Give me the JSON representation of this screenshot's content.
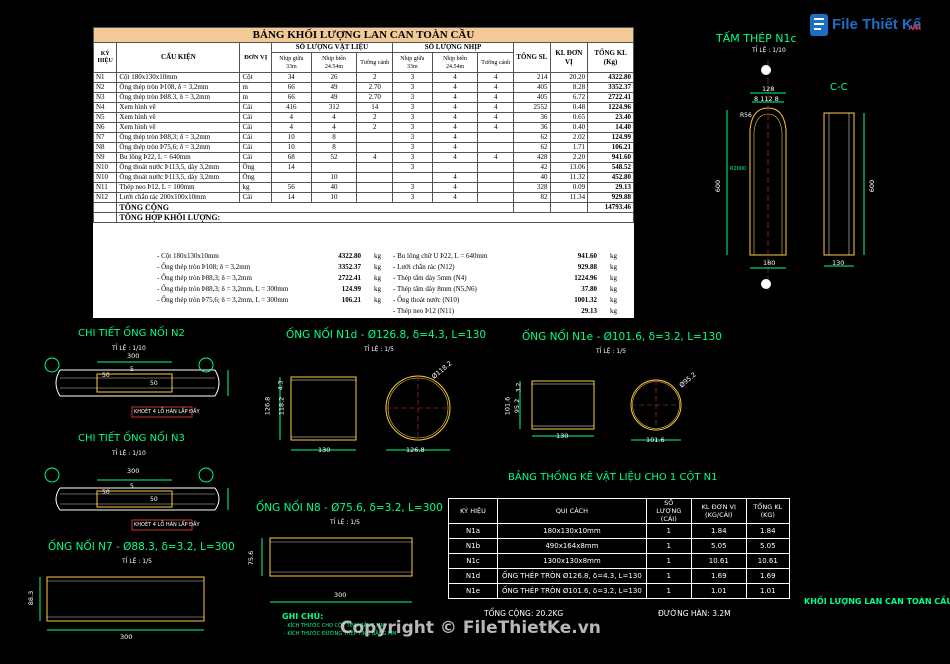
{
  "logo": {
    "brand": "File Thiết Kế",
    "domain": ".vn"
  },
  "watermark": "Copyright © FileThietKe.vn",
  "bom": {
    "title": "BẢNG KHỐI LƯỢNG LAN CAN TOÀN CẦU",
    "headers": {
      "kyhieu": "KÝ HIỆU",
      "caukien": "CẤU KIỆN",
      "donvi": "ĐƠN VỊ",
      "sl_vatlieu": "SỐ LƯỢNG VẬT LIỆU",
      "sl_nhip": "SỐ LƯỢNG NHỊP",
      "tong_sl": "TỔNG SL",
      "kl_donvi": "KL ĐƠN VỊ",
      "tong_kl": "TỔNG KL (Kg)",
      "nhip_giua": "Nhịp giữa 33m",
      "nhip_bien": "Nhịp biên 24.54m",
      "tuong_canh": "Tường cánh"
    },
    "rows": [
      {
        "id": "N1",
        "name": "Cột 180x130x10mm",
        "unit": "Cột",
        "a": "34",
        "b": "26",
        "c": "2",
        "d": "3",
        "e": "4",
        "f": "4",
        "sl": "214",
        "kl": "20.20",
        "tkl": "4322.80"
      },
      {
        "id": "N2",
        "name": "Ống thép tròn Þ108, δ = 3,2mm",
        "unit": "m",
        "a": "66",
        "b": "49",
        "c": "2.70",
        "d": "3",
        "e": "4",
        "f": "4",
        "sl": "405",
        "kl": "8.28",
        "tkl": "3352.37"
      },
      {
        "id": "N3",
        "name": "Ống thép tròn Þ88.3, δ = 3,2mm",
        "unit": "m",
        "a": "66",
        "b": "49",
        "c": "2.70",
        "d": "3",
        "e": "4",
        "f": "4",
        "sl": "405",
        "kl": "6.72",
        "tkl": "2722.41"
      },
      {
        "id": "N4",
        "name": "Xem hình vẽ",
        "unit": "Cái",
        "a": "416",
        "b": "312",
        "c": "14",
        "d": "3",
        "e": "4",
        "f": "4",
        "sl": "2552",
        "kl": "0.48",
        "tkl": "1224.96"
      },
      {
        "id": "N5",
        "name": "Xem hình vẽ",
        "unit": "Cái",
        "a": "4",
        "b": "4",
        "c": "2",
        "d": "3",
        "e": "4",
        "f": "4",
        "sl": "36",
        "kl": "0.65",
        "tkl": "23.40"
      },
      {
        "id": "N6",
        "name": "Xem hình vẽ",
        "unit": "Cái",
        "a": "4",
        "b": "4",
        "c": "2",
        "d": "3",
        "e": "4",
        "f": "4",
        "sl": "36",
        "kl": "0.40",
        "tkl": "14.40"
      },
      {
        "id": "N7",
        "name": "Ống thép tròn Þ88,3; δ = 3,2mm",
        "unit": "Cái",
        "a": "10",
        "b": "8",
        "c": "",
        "d": "3",
        "e": "4",
        "f": "",
        "sl": "62",
        "kl": "2.02",
        "tkl": "124.99"
      },
      {
        "id": "N8",
        "name": "Ống thép tròn Þ75,6; δ = 3,2mm",
        "unit": "Cái",
        "a": "10",
        "b": "8",
        "c": "",
        "d": "3",
        "e": "4",
        "f": "",
        "sl": "62",
        "kl": "1.71",
        "tkl": "106.21"
      },
      {
        "id": "N9",
        "name": "Bu lông Þ22, L = 640mm",
        "unit": "Cái",
        "a": "68",
        "b": "52",
        "c": "4",
        "d": "3",
        "e": "4",
        "f": "4",
        "sl": "428",
        "kl": "2.20",
        "tkl": "941.60"
      },
      {
        "id": "N10",
        "name": "Ống thoát nước Þ113,5, dày 3,2mm",
        "unit": "Ống",
        "a": "14",
        "b": "",
        "c": "",
        "d": "3",
        "e": "",
        "f": "",
        "sl": "42",
        "kl": "13.06",
        "tkl": "548.52"
      },
      {
        "id": "N10",
        "name": "Ống thoát nước Þ113,5, dày 3,2mm",
        "unit": "Ống",
        "a": "",
        "b": "10",
        "c": "",
        "d": "",
        "e": "4",
        "f": "",
        "sl": "40",
        "kl": "11.32",
        "tkl": "452.80"
      },
      {
        "id": "N11",
        "name": "Thép neo Þ12, L = 100mm",
        "unit": "kg",
        "a": "56",
        "b": "40",
        "c": "",
        "d": "3",
        "e": "4",
        "f": "",
        "sl": "328",
        "kl": "0.09",
        "tkl": "29.13"
      },
      {
        "id": "N12",
        "name": "Lưới chắn rác 200x100x10mm",
        "unit": "Cái",
        "a": "14",
        "b": "10",
        "c": "",
        "d": "3",
        "e": "4",
        "f": "",
        "sl": "82",
        "kl": "11.34",
        "tkl": "929.88"
      }
    ],
    "total_label": "TỔNG CỘNG",
    "total_value": "14793.46",
    "summary_title": "TỔNG HỢP KHỐI LƯỢNG:",
    "summary_left": [
      {
        "name": "- Cột 180x130x10mm",
        "val": "4322.80",
        "unit": "kg"
      },
      {
        "name": "- Ống thép tròn Þ108; δ = 3,2mm",
        "val": "3352.37",
        "unit": "kg"
      },
      {
        "name": "- Ống thép tròn Þ88,3; δ = 3,2mm",
        "val": "2722.41",
        "unit": "kg"
      },
      {
        "name": "- Ống thép tròn Þ88,3; δ = 3,2mm, L = 300mm",
        "val": "124.99",
        "unit": "kg"
      },
      {
        "name": "- Ống thép tròn Þ75,6; δ = 3,2mm, L = 300mm",
        "val": "106.21",
        "unit": "kg"
      }
    ],
    "summary_right": [
      {
        "name": "- Bu lông chữ U Þ22, L = 640mm",
        "val": "941.60",
        "unit": "kg"
      },
      {
        "name": "- Lưới chắn rác (N12)",
        "val": "929.88",
        "unit": "kg"
      },
      {
        "name": "- Thép tấm dày 5mm (N4)",
        "val": "1224.96",
        "unit": "kg"
      },
      {
        "name": "- Thép tấm dày 8mm (N5,N6)",
        "val": "37.80",
        "unit": "kg"
      },
      {
        "name": "- Ống thoát nước (N10)",
        "val": "1001.32",
        "unit": "kg"
      },
      {
        "name": "- Thép neo Þ12 (N11)",
        "val": "29.13",
        "unit": "kg"
      }
    ]
  },
  "drawings": {
    "n1c_title": "TẤM THÉP N1c",
    "n1c_scale": "TỈ LỆ : 1/10",
    "cc_title": "C-C",
    "n1c_dims": {
      "top": "128",
      "mid": "8 112 8",
      "r": "R56",
      "r2": "R2000",
      "h": "600",
      "w": "180",
      "cc_h": "600",
      "cc_w": "130"
    },
    "n2_title": "CHI TIẾT ỐNG NỐI N2",
    "n2_scale": "TỈ LỆ : 1/10",
    "n2_dims": {
      "l": "300",
      "a": "50",
      "b": "5",
      "c": "50"
    },
    "n2_note": "KHOÉT 4 LỖ HÀN LẤP ĐẦY",
    "n3_title": "CHI TIẾT ỐNG NỐI N3",
    "n3_scale": "TỈ LỆ : 1/10",
    "n3_dims": {
      "l": "300",
      "a": "50",
      "b": "5",
      "c": "50"
    },
    "n3_note": "KHOÉT 4 LỖ HÀN LẤP ĐẦY",
    "n1d_title": "ỐNG NỐI N1d - Ø126.8, δ=4.3, L=130",
    "n1d_scale": "TỈ LỆ : 1/5",
    "n1d_dims": {
      "h": "126.8",
      "h2": "118.2",
      "t": "4.3",
      "w": "130",
      "d": "126.8",
      "dd": "Ø118.2"
    },
    "n1e_title": "ỐNG NỐI N1e - Ø101.6, δ=3.2, L=130",
    "n1e_scale": "TỈ LỆ : 1/5",
    "n1e_dims": {
      "h": "101.6",
      "h2": "95.2",
      "t": "3.2",
      "w": "130",
      "d": "101.6",
      "dd": "Ø95.2"
    },
    "n8_title": "ỐNG NỐI N8 - Ø75.6, δ=3.2, L=300",
    "n8_scale": "TỈ LỆ : 1/5",
    "n8_dims": {
      "h": "75.6",
      "w": "300"
    },
    "n7_title": "ỐNG NỐI N7 - Ø88.3, δ=3.2, L=300",
    "n7_scale": "TỈ LỆ : 1/5",
    "n7_dims": {
      "h": "88.3",
      "w": "300"
    },
    "notes_title": "GHI CHÚ:",
    "notes": [
      "- KÍCH THƯỚC CHO CỘT TÍNH BẰNG MM",
      "- KÍCH THƯỚC ĐƯỜNG THÉP TÍNH BẰNG MM"
    ],
    "bottom_right": "KHỐI LƯỢNG LAN CAN TOÀN CẦU"
  },
  "tk": {
    "title": "BẢNG THỐNG KÊ VẬT LIỆU CHO 1 CỘT N1",
    "headers": [
      "KÝ HIỆU",
      "QUI CÁCH",
      "SỐ LƯỢNG (CÁI)",
      "KL ĐƠN VỊ (KG/CÁI)",
      "TỔNG KL (KG)"
    ],
    "rows": [
      [
        "N1a",
        "180x130x10mm",
        "1",
        "1.84",
        "1.84"
      ],
      [
        "N1b",
        "490x164x8mm",
        "1",
        "5.05",
        "5.05"
      ],
      [
        "N1c",
        "1300x130x8mm",
        "1",
        "10.61",
        "10.61"
      ],
      [
        "N1d",
        "ỐNG THÉP TRÒN Ø126.8, δ=4.3, L=130",
        "1",
        "1.69",
        "1.69"
      ],
      [
        "N1e",
        "ỐNG THÉP TRÒN Ø101.6, δ=3.2, L=130",
        "1",
        "1.01",
        "1.01"
      ]
    ],
    "total": "TỔNG CỘNG:  20.2KG",
    "weld": "ĐƯỜNG HÀN:  3.2M"
  }
}
